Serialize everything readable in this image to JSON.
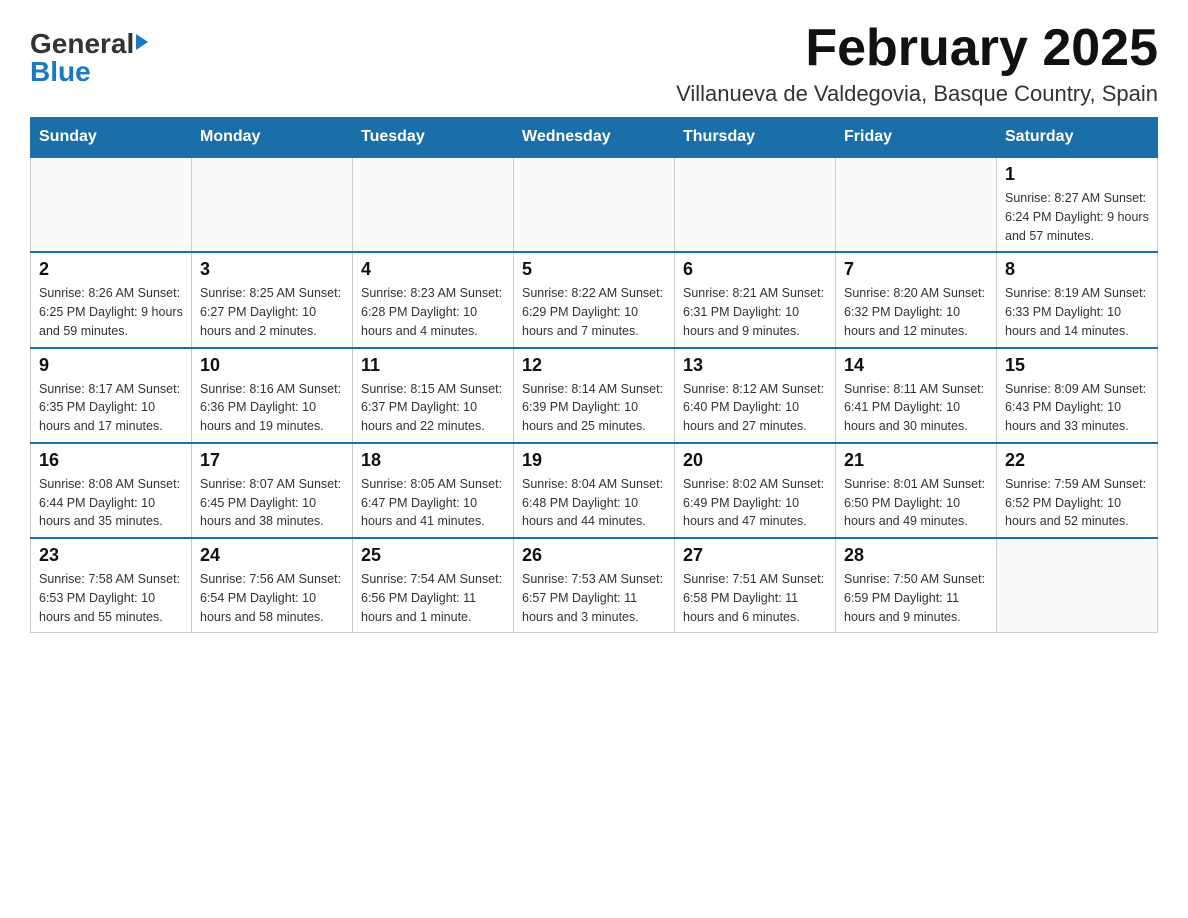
{
  "header": {
    "logo_general": "General",
    "logo_blue": "Blue",
    "month_title": "February 2025",
    "location": "Villanueva de Valdegovia, Basque Country, Spain"
  },
  "days_of_week": [
    "Sunday",
    "Monday",
    "Tuesday",
    "Wednesday",
    "Thursday",
    "Friday",
    "Saturday"
  ],
  "weeks": [
    [
      {
        "day": "",
        "info": ""
      },
      {
        "day": "",
        "info": ""
      },
      {
        "day": "",
        "info": ""
      },
      {
        "day": "",
        "info": ""
      },
      {
        "day": "",
        "info": ""
      },
      {
        "day": "",
        "info": ""
      },
      {
        "day": "1",
        "info": "Sunrise: 8:27 AM\nSunset: 6:24 PM\nDaylight: 9 hours and 57 minutes."
      }
    ],
    [
      {
        "day": "2",
        "info": "Sunrise: 8:26 AM\nSunset: 6:25 PM\nDaylight: 9 hours and 59 minutes."
      },
      {
        "day": "3",
        "info": "Sunrise: 8:25 AM\nSunset: 6:27 PM\nDaylight: 10 hours and 2 minutes."
      },
      {
        "day": "4",
        "info": "Sunrise: 8:23 AM\nSunset: 6:28 PM\nDaylight: 10 hours and 4 minutes."
      },
      {
        "day": "5",
        "info": "Sunrise: 8:22 AM\nSunset: 6:29 PM\nDaylight: 10 hours and 7 minutes."
      },
      {
        "day": "6",
        "info": "Sunrise: 8:21 AM\nSunset: 6:31 PM\nDaylight: 10 hours and 9 minutes."
      },
      {
        "day": "7",
        "info": "Sunrise: 8:20 AM\nSunset: 6:32 PM\nDaylight: 10 hours and 12 minutes."
      },
      {
        "day": "8",
        "info": "Sunrise: 8:19 AM\nSunset: 6:33 PM\nDaylight: 10 hours and 14 minutes."
      }
    ],
    [
      {
        "day": "9",
        "info": "Sunrise: 8:17 AM\nSunset: 6:35 PM\nDaylight: 10 hours and 17 minutes."
      },
      {
        "day": "10",
        "info": "Sunrise: 8:16 AM\nSunset: 6:36 PM\nDaylight: 10 hours and 19 minutes."
      },
      {
        "day": "11",
        "info": "Sunrise: 8:15 AM\nSunset: 6:37 PM\nDaylight: 10 hours and 22 minutes."
      },
      {
        "day": "12",
        "info": "Sunrise: 8:14 AM\nSunset: 6:39 PM\nDaylight: 10 hours and 25 minutes."
      },
      {
        "day": "13",
        "info": "Sunrise: 8:12 AM\nSunset: 6:40 PM\nDaylight: 10 hours and 27 minutes."
      },
      {
        "day": "14",
        "info": "Sunrise: 8:11 AM\nSunset: 6:41 PM\nDaylight: 10 hours and 30 minutes."
      },
      {
        "day": "15",
        "info": "Sunrise: 8:09 AM\nSunset: 6:43 PM\nDaylight: 10 hours and 33 minutes."
      }
    ],
    [
      {
        "day": "16",
        "info": "Sunrise: 8:08 AM\nSunset: 6:44 PM\nDaylight: 10 hours and 35 minutes."
      },
      {
        "day": "17",
        "info": "Sunrise: 8:07 AM\nSunset: 6:45 PM\nDaylight: 10 hours and 38 minutes."
      },
      {
        "day": "18",
        "info": "Sunrise: 8:05 AM\nSunset: 6:47 PM\nDaylight: 10 hours and 41 minutes."
      },
      {
        "day": "19",
        "info": "Sunrise: 8:04 AM\nSunset: 6:48 PM\nDaylight: 10 hours and 44 minutes."
      },
      {
        "day": "20",
        "info": "Sunrise: 8:02 AM\nSunset: 6:49 PM\nDaylight: 10 hours and 47 minutes."
      },
      {
        "day": "21",
        "info": "Sunrise: 8:01 AM\nSunset: 6:50 PM\nDaylight: 10 hours and 49 minutes."
      },
      {
        "day": "22",
        "info": "Sunrise: 7:59 AM\nSunset: 6:52 PM\nDaylight: 10 hours and 52 minutes."
      }
    ],
    [
      {
        "day": "23",
        "info": "Sunrise: 7:58 AM\nSunset: 6:53 PM\nDaylight: 10 hours and 55 minutes."
      },
      {
        "day": "24",
        "info": "Sunrise: 7:56 AM\nSunset: 6:54 PM\nDaylight: 10 hours and 58 minutes."
      },
      {
        "day": "25",
        "info": "Sunrise: 7:54 AM\nSunset: 6:56 PM\nDaylight: 11 hours and 1 minute."
      },
      {
        "day": "26",
        "info": "Sunrise: 7:53 AM\nSunset: 6:57 PM\nDaylight: 11 hours and 3 minutes."
      },
      {
        "day": "27",
        "info": "Sunrise: 7:51 AM\nSunset: 6:58 PM\nDaylight: 11 hours and 6 minutes."
      },
      {
        "day": "28",
        "info": "Sunrise: 7:50 AM\nSunset: 6:59 PM\nDaylight: 11 hours and 9 minutes."
      },
      {
        "day": "",
        "info": ""
      }
    ]
  ]
}
